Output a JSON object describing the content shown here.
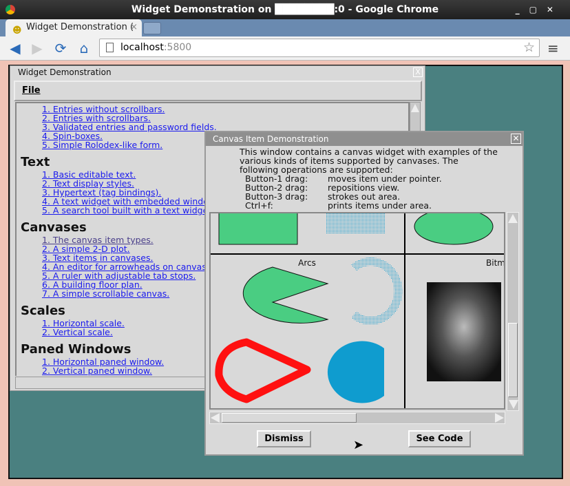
{
  "browser": {
    "window_title": "Widget Demonstration on ████████:0 - Google Chrome",
    "tab_title": "Widget Demonstration (",
    "url_host": "localhost",
    "url_port": ":5800"
  },
  "demo_window": {
    "title": "Widget Demonstration",
    "menu_file": "File",
    "sections": [
      {
        "heading": "",
        "items": [
          "1. Entries without scrollbars.",
          "2. Entries with scrollbars.",
          "3. Validated entries and password fields.",
          "4. Spin-boxes.",
          "5. Simple Rolodex-like form."
        ]
      },
      {
        "heading": "Text",
        "items": [
          "1. Basic editable text.",
          "2. Text display styles.",
          "3. Hypertext (tag bindings).",
          "4. A text widget with embedded windows",
          "5. A search tool built with a text widget."
        ]
      },
      {
        "heading": "Canvases",
        "items": [
          "1. The canvas item types.",
          "2. A simple 2-D plot.",
          "3. Text items in canvases.",
          "4. An editor for arrowheads on canvas lines",
          "5. A ruler with adjustable tab stops.",
          "6. A building floor plan.",
          "7. A simple scrollable canvas."
        ]
      },
      {
        "heading": "Scales",
        "items": [
          "1. Horizontal scale.",
          "2. Vertical scale."
        ]
      },
      {
        "heading": "Paned Windows",
        "items": [
          "1. Horizontal paned window.",
          "2. Vertical paned window."
        ]
      }
    ]
  },
  "canvas_window": {
    "title": "Canvas Item Demonstration",
    "intro": [
      "This window contains a canvas widget with examples of the",
      "various kinds of items supported by canvases.  The",
      "following operations are supported:"
    ],
    "operations": [
      [
        "Button-1 drag:",
        "moves item under pointer."
      ],
      [
        "Button-2 drag:",
        "repositions view."
      ],
      [
        "Button-3 drag:",
        "strokes out area."
      ],
      [
        "Ctrl+f:",
        "prints items under area."
      ]
    ],
    "labels": {
      "arcs": "Arcs",
      "bitmaps": "Bitm"
    },
    "dismiss": "Dismiss",
    "see_code": "See Code",
    "colors": {
      "green": "#4acd82",
      "blue": "#0f9ccf",
      "red": "#ff1010"
    }
  }
}
